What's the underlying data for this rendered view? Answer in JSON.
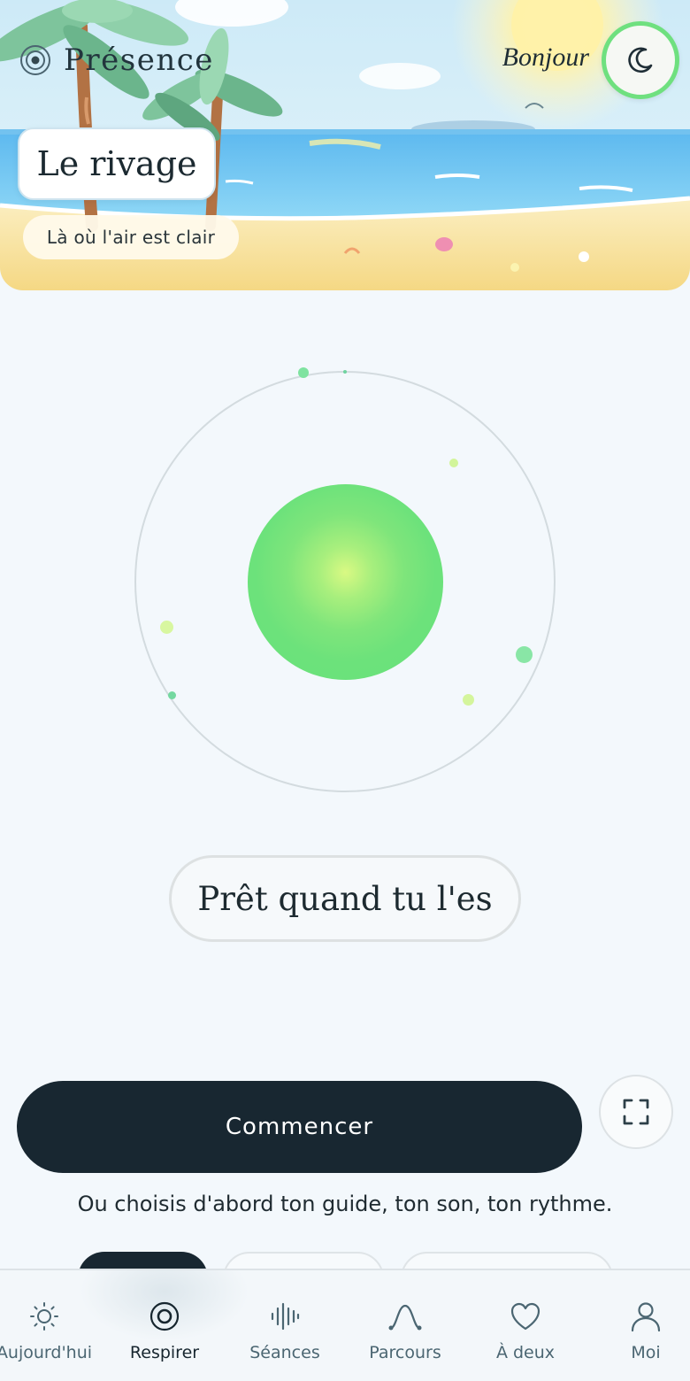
{
  "app": {
    "brand": "Présence",
    "greeting": "Bonjour"
  },
  "hero": {
    "place_title": "Le rivage",
    "place_subtitle": "Là où l'air est clair",
    "theme_toggle_icon": "moon-icon"
  },
  "breath": {
    "phase_label": "Prêt quand tu l'es"
  },
  "actions": {
    "start_label": "Commencer",
    "fullscreen_icon": "fullscreen-icon",
    "hint": "Ou choisis d'abord ton guide, ton son, ton rythme."
  },
  "nav": {
    "items": [
      {
        "label": "Aujourd'hui",
        "icon": "sun-icon",
        "active": false
      },
      {
        "label": "Respirer",
        "icon": "target-icon",
        "active": true
      },
      {
        "label": "Séances",
        "icon": "waveform-icon",
        "active": false
      },
      {
        "label": "Parcours",
        "icon": "path-icon",
        "active": false
      },
      {
        "label": "À deux",
        "icon": "heart-icon",
        "active": false
      },
      {
        "label": "Moi",
        "icon": "person-icon",
        "active": false
      }
    ]
  },
  "colors": {
    "accent_green": "#6ce27b",
    "dark": "#182731",
    "background": "#f3f8fc"
  }
}
